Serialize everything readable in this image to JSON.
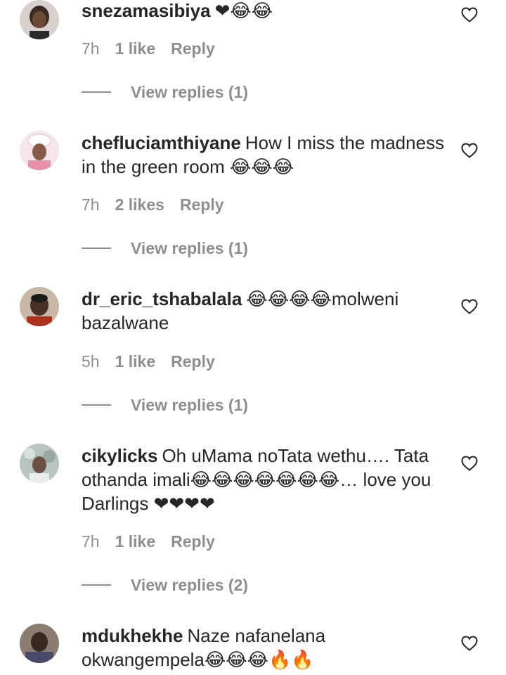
{
  "comments": [
    {
      "username": "snezamasibiya",
      "text": "❤😂😂",
      "time": "7h",
      "likes": "1 like",
      "reply": "Reply",
      "view_replies": "View replies (1)"
    },
    {
      "username": "chefluciamthiyane",
      "text": "How I miss the madness in the green room 😂😂😂",
      "time": "7h",
      "likes": "2 likes",
      "reply": "Reply",
      "view_replies": "View replies (1)"
    },
    {
      "username": "dr_eric_tshabalala",
      "text": "😂😂😂😂molweni bazalwane",
      "time": "5h",
      "likes": "1 like",
      "reply": "Reply",
      "view_replies": "View replies (1)"
    },
    {
      "username": "cikylicks",
      "text": "Oh uMama noTata wethu…. Tata othanda imali😂😂😂😂😂😂😂… love you Darlings ❤❤❤❤",
      "time": "7h",
      "likes": "1 like",
      "reply": "Reply",
      "view_replies": "View replies (2)"
    },
    {
      "username": "mdukhekhe",
      "text": "Naze nafanelana okwangempela😂😂😂🔥🔥",
      "time": "",
      "likes": "",
      "reply": "",
      "view_replies": ""
    }
  ],
  "icons": {
    "heart": "heart-outline-icon",
    "heart_color": "#262626",
    "muted_text_color": "#8e8e8e"
  }
}
